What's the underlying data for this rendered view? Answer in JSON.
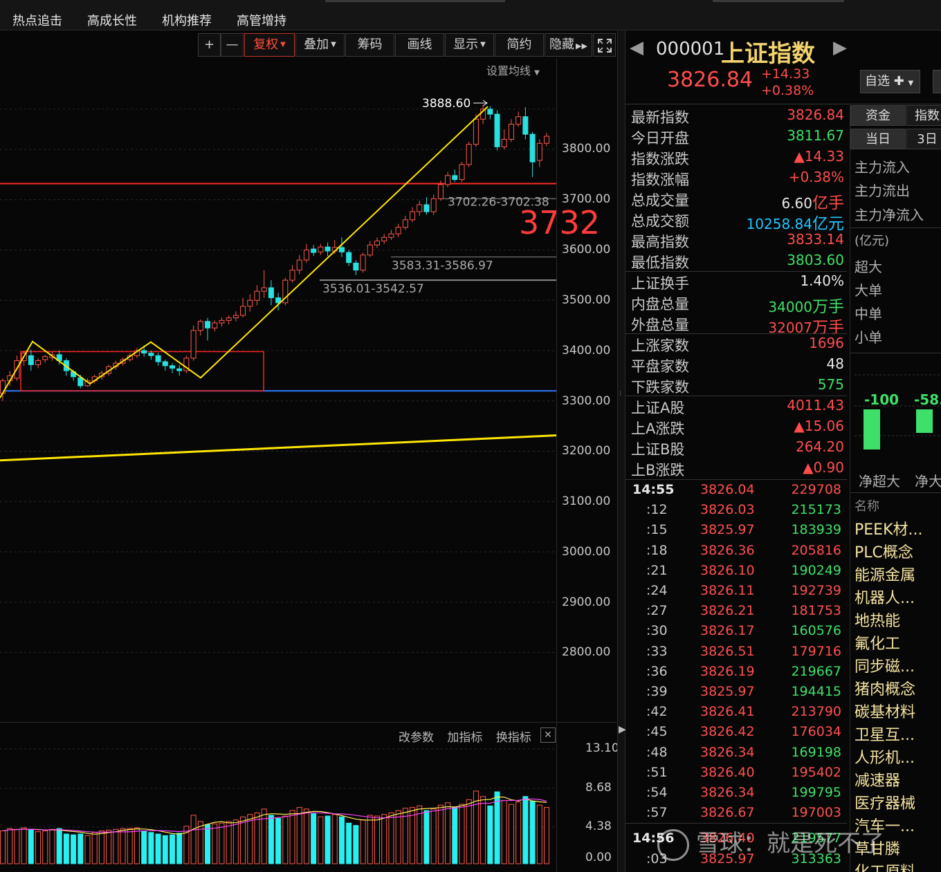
{
  "topnav": {
    "tabs": [
      "热点追击",
      "高成长性",
      "机构推荐",
      "高管增持"
    ]
  },
  "toolbar": {
    "plus": "+",
    "minus": "—",
    "fuquan": "复权",
    "diejia": "叠加",
    "chouma": "筹码",
    "huaxian": "画线",
    "xianshi": "显示",
    "jianyue": "简约",
    "yincang": "隐藏",
    "expand_icon": "expand-icon"
  },
  "ma_setting": "设置均线",
  "chart_data": {
    "type": "candlestick",
    "ylim": [
      2750,
      3900
    ],
    "y_ticks": [
      "3800.00",
      "3700.00",
      "3600.00",
      "3500.00",
      "3400.00",
      "3300.00",
      "3200.00",
      "3100.00",
      "3000.00",
      "2900.00",
      "2800.00"
    ],
    "annotations": {
      "high_label": "3888.60",
      "gap1": "3702.26-3702.38",
      "gap2": "3583.31-3586.97",
      "gap3": "3536.01-3542.57",
      "big_label": "3732"
    },
    "lines": {
      "red_horizontal": 3732,
      "blue_horizontal": 3320,
      "yellow_trend_start": 3190,
      "yellow_trend_end": 3230
    },
    "box": {
      "low": 3320,
      "high": 3398
    },
    "volume": {
      "y_ticks": [
        "13.10",
        "8.68",
        "4.38",
        "0.00"
      ],
      "tools": [
        "改参数",
        "加指标",
        "换指标"
      ],
      "close": "✕"
    }
  },
  "index": {
    "code": "000001",
    "name": "上证指数",
    "price": "3826.84",
    "change": "+14.33",
    "change_pct": "+0.38%",
    "watch_label": "自选 ✚",
    "prev_arrow": "◀",
    "next_arrow": "▶"
  },
  "stats": [
    {
      "k": "最新指数",
      "v": "3826.84",
      "c": "#ff4d4d"
    },
    {
      "k": "今日开盘",
      "v": "3811.67",
      "c": "#3ee06a"
    },
    {
      "k": "指数涨跌",
      "v": "▲14.33",
      "c": "#ff4d4d"
    },
    {
      "k": "指数涨幅",
      "v": "+0.38%",
      "c": "#ff4d4d"
    },
    {
      "k": "总成交量",
      "v": "6.60",
      "u": "亿手",
      "c": "#e8e8e8"
    },
    {
      "k": "总成交额",
      "v": "10258.84",
      "u": "亿元",
      "c": "#22c6ff"
    },
    {
      "k": "最高指数",
      "v": "3833.14",
      "c": "#ff4d4d"
    },
    {
      "k": "最低指数",
      "v": "3803.60",
      "c": "#3ee06a"
    },
    {
      "k": "上证换手",
      "v": "1.40%",
      "c": "#e8e8e8"
    },
    {
      "k": "内盘总量",
      "v": "34000",
      "u": "万手",
      "c": "#3ee06a"
    },
    {
      "k": "外盘总量",
      "v": "32007",
      "u": "万手",
      "c": "#ff4d4d"
    },
    {
      "k": "上涨家数",
      "v": "1696",
      "c": "#ff4d4d"
    },
    {
      "k": "平盘家数",
      "v": "48",
      "c": "#e8e8e8"
    },
    {
      "k": "下跌家数",
      "v": "575",
      "c": "#3ee06a"
    },
    {
      "k": "上证A股",
      "v": "4011.43",
      "c": "#ff4d4d"
    },
    {
      "k": "上A涨跌",
      "v": "▲15.06",
      "c": "#ff4d4d"
    },
    {
      "k": "上证B股",
      "v": "264.20",
      "c": "#ff4d4d"
    },
    {
      "k": "上B涨跌",
      "v": "▲0.90",
      "c": "#ff4d4d"
    }
  ],
  "ticks": [
    {
      "t": "14:55",
      "p": "3826.04",
      "q": "229708",
      "c": "#ff5050"
    },
    {
      "t": ":12",
      "p": "3826.03",
      "q": "215173",
      "c": "#3ee06a"
    },
    {
      "t": ":15",
      "p": "3825.97",
      "q": "183939",
      "c": "#3ee06a"
    },
    {
      "t": ":18",
      "p": "3826.36",
      "q": "205816",
      "c": "#ff5050"
    },
    {
      "t": ":21",
      "p": "3826.10",
      "q": "190249",
      "c": "#3ee06a"
    },
    {
      "t": ":24",
      "p": "3826.11",
      "q": "192739",
      "c": "#ff5050"
    },
    {
      "t": ":27",
      "p": "3826.21",
      "q": "181753",
      "c": "#ff5050"
    },
    {
      "t": ":30",
      "p": "3826.17",
      "q": "160576",
      "c": "#3ee06a"
    },
    {
      "t": ":33",
      "p": "3826.51",
      "q": "179716",
      "c": "#ff5050"
    },
    {
      "t": ":36",
      "p": "3826.19",
      "q": "219667",
      "c": "#3ee06a"
    },
    {
      "t": ":39",
      "p": "3825.97",
      "q": "194415",
      "c": "#3ee06a"
    },
    {
      "t": ":42",
      "p": "3826.41",
      "q": "213790",
      "c": "#ff5050"
    },
    {
      "t": ":45",
      "p": "3826.42",
      "q": "176034",
      "c": "#ff5050"
    },
    {
      "t": ":48",
      "p": "3826.34",
      "q": "169198",
      "c": "#3ee06a"
    },
    {
      "t": ":51",
      "p": "3826.40",
      "q": "195402",
      "c": "#ff5050"
    },
    {
      "t": ":54",
      "p": "3826.34",
      "q": "199795",
      "c": "#3ee06a"
    },
    {
      "t": ":57",
      "p": "3826.67",
      "q": "197003",
      "c": "#ff5050"
    },
    {
      "t": "14:56",
      "p": "3826.40",
      "q": "219577",
      "c": "#3ee06a"
    },
    {
      "t": ":03",
      "p": "3825.97",
      "q": "313363",
      "c": "#3ee06a"
    }
  ],
  "fund": {
    "tab1": "资金",
    "tab2": "指数",
    "tab3": "当日",
    "tab4": "3日",
    "rows1": [
      "主力流入",
      "主力流出",
      "主力净流入"
    ],
    "unit": "(亿元)",
    "rows2": [
      "超大",
      "大单",
      "中单",
      "小单"
    ],
    "bar_vals": [
      "-100",
      "-58."
    ],
    "bar_labels": [
      "净超大",
      "净大"
    ],
    "list_header": "名称",
    "sectors": [
      "PEEK材...",
      "PLC概念",
      "能源金属",
      "机器人...",
      "地热能",
      "氟化工",
      "同步磁...",
      "猪肉概念",
      "碳基材料",
      "卫星互...",
      "人形机...",
      "减速器",
      "医疗器械",
      "汽车一...",
      "草甘膦",
      "化工原料"
    ]
  },
  "watermark": "雪球：就是死不了"
}
